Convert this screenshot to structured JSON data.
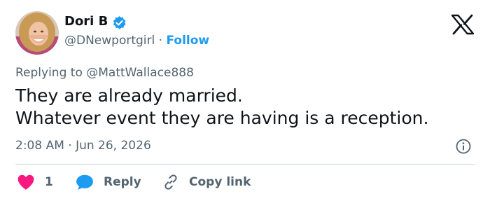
{
  "author": {
    "display_name": "Dori B",
    "handle": "@DNewportgirl",
    "separator": "·",
    "follow_label": "Follow"
  },
  "tweet": {
    "replying_prefix": "Replying to",
    "replying_handle": "@MattWallace888",
    "text_lines": [
      "They are already married.",
      "Whatever event they are having is a reception."
    ],
    "timestamp": "2:08 AM · Jun 26, 2026"
  },
  "actions": {
    "like_count": "1",
    "reply_label": "Reply",
    "copy_link_label": "Copy link"
  },
  "colors": {
    "accent": "#1d9bf0",
    "like": "#f91880",
    "secondary_text": "#536471"
  }
}
